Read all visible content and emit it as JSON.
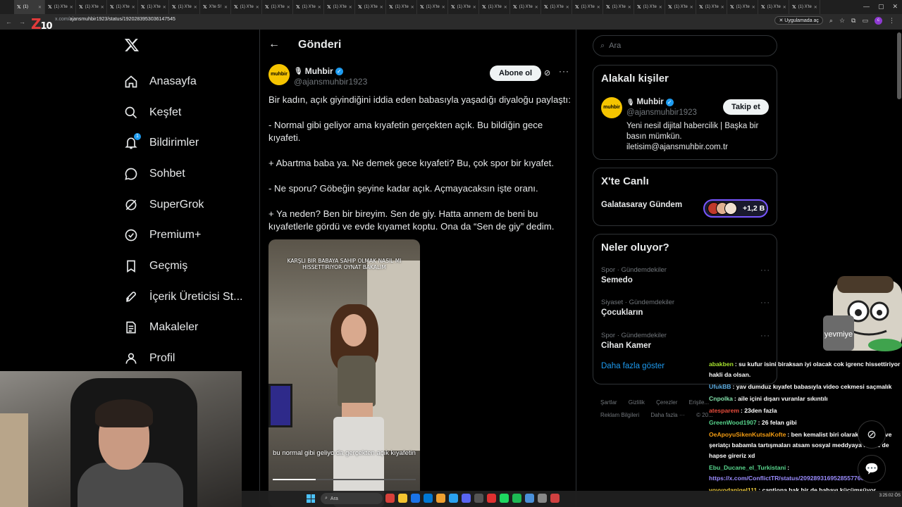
{
  "browser": {
    "active_tab": "(1) ",
    "tabs": [
      "(1) X'te",
      "(1) X'te",
      "(1) X'te",
      "(1) X'te",
      "(1) X'te",
      "X'te S!",
      "(1) X'te",
      "(1) X'te",
      "(1) X'te",
      "(1) X'te",
      "(1) X'te",
      "(1) X'te",
      "(1) X'te",
      "(1) X'te",
      "(1) X'te",
      "(1) X'te",
      "(1) X'te",
      "(1) X'te",
      "(1) X'te",
      "(1) X'te",
      "(1) X'te",
      "(1) X'te",
      "(1) X'te",
      "(1) X'te",
      "(1) X'te"
    ],
    "url_prefix": "x.com/",
    "url_path": "ajansmuhbir1923/status/1920283953036147545",
    "open_in_app": "Uygulamada aç",
    "stream_logo_main": "Z",
    "stream_logo_num": "10"
  },
  "nav": {
    "items": [
      {
        "label": "Anasayfa",
        "icon": "home-icon"
      },
      {
        "label": "Keşfet",
        "icon": "search-icon"
      },
      {
        "label": "Bildirimler",
        "icon": "bell-icon",
        "badge": "1"
      },
      {
        "label": "Sohbet",
        "icon": "chat-icon"
      },
      {
        "label": "SuperGrok",
        "icon": "grok-icon"
      },
      {
        "label": "Premium+",
        "icon": "premium-icon"
      },
      {
        "label": "Geçmiş",
        "icon": "bookmark-icon"
      },
      {
        "label": "İçerik Üreticisi St...",
        "icon": "rocket-icon"
      },
      {
        "label": "Makaleler",
        "icon": "article-icon"
      },
      {
        "label": "Profil",
        "icon": "profile-icon"
      }
    ]
  },
  "post": {
    "header_title": "Gönderi",
    "author_name": "Muhbir",
    "author_avatar_text": "muhbir",
    "author_handle": "@ajansmuhbir1923",
    "subscribe_label": "Abone ol",
    "paragraphs": [
      "Bir kadın, açık giyindiğini iddia eden babasıyla yaşadığı diyaloğu paylaştı:",
      "- Normal gibi geliyor ama kıyafetin gerçekten açık. Bu bildiğin gece kıyafeti.",
      "+ Abartma baba ya. Ne demek gece kıyafeti? Bu, çok spor bir kıyafet.",
      "- Ne sporu? Göbeğin şeyine kadar açık. Açmayacaksın işte oranı.",
      "+ Ya neden? Ben bir bireyim. Sen de giy. Hatta annem de beni bu kıyafetlerle gördü ve evde kıyamet koptu. Ona da “Sen de giy” dedim."
    ],
    "media_caption_top": "KARŞLI BIR BABAYA SAHIP OLMAK NASIL MI HISSETTIRIYOR OYNAT BAKALIM",
    "media_caption_bottom": "bu normal gibi geliyo da gerçekten açık kıyafetin",
    "video_progress": 0.3
  },
  "right": {
    "search_placeholder": "Ara",
    "related": {
      "title": "Alakalı kişiler",
      "name": "Muhbir",
      "avatar_text": "muhbir",
      "handle": "@ajansmuhbir1923",
      "follow_label": "Takip et",
      "bio": "Yeni nesil dijital habercilik | Başka bir basın mümkün. iletisim@ajansmuhbir.com.tr"
    },
    "live": {
      "title": "X'te Canlı",
      "topic": "Galatasaray Gündem",
      "count": "+1,2 B"
    },
    "trends": {
      "title": "Neler oluyor?",
      "items": [
        {
          "meta": "Spor · Gündemdekiler",
          "name": "Semedo"
        },
        {
          "meta": "Siyaset · Gündemdekiler",
          "name": "Çocukların"
        },
        {
          "meta": "Spor · Gündemdekiler",
          "name": "Cihan Kamer"
        }
      ],
      "show_more": "Daha fazla göster"
    },
    "footer": {
      "row1": [
        "Şartlar",
        "Gizlilik",
        "Çerezler",
        "Erişile..."
      ],
      "row2": [
        "Reklam Bilgileri",
        "Daha fazla ···",
        "© 20..."
      ]
    }
  },
  "overlay": {
    "mascot_text": "yevmiye",
    "chat": [
      {
        "user": "abakben",
        "color": "#a6e22e",
        "text": ": su kufur isini biraksan iyi olacak cok igrenc hissettiriyor hakli da olsan."
      },
      {
        "user": "UfukBB",
        "color": "#5dade2",
        "text": ": yav dumduz kıyafet babasıyla video cekmesi saçmalık"
      },
      {
        "user": "Cnpolka",
        "color": "#82e0aa",
        "text": ": aile içini dışarı vuranlar sıkıntılı"
      },
      {
        "user": "atesparem",
        "color": "#e74c3c",
        "text": ": 23den fazla"
      },
      {
        "user": "GreenWood1907",
        "color": "#58d68d",
        "text": ": 26 felan gibi"
      },
      {
        "user": "OeApoyuSikenKutsalKofte",
        "color": "#f39c12",
        "text": ": ben kemalist biri olarak tarikatçı ve şeriatçı babamla tartışmaları atsam sosyal meddyaya ikimiz de hapse gireriz xd"
      },
      {
        "user": "Ebu_Ducane_el_Turkistani",
        "color": "#58d68d",
        "text": ":",
        "link": "https://x.com/ConflictTR/status/2092893169528557766?s=20"
      },
      {
        "user": "voyvodanigel111",
        "color": "#f4d03f",
        "text": ": captiona bak bir de babayı küçümsüyor"
      }
    ]
  },
  "taskbar": {
    "search": "Ara",
    "time": "3:25:02 ÖS",
    "icon_colors": [
      "#d7403a",
      "#f4c430",
      "#1a73e8",
      "#0078d4",
      "#f0a030",
      "#2aa1f0",
      "#5865f2",
      "#555555",
      "#e03030",
      "#1ed760",
      "#1db954",
      "#4a90d9",
      "#888888",
      "#d04040"
    ]
  },
  "colors": {
    "accent": "#1d9bf0",
    "background": "#000000",
    "live_border": "#7856ff"
  }
}
